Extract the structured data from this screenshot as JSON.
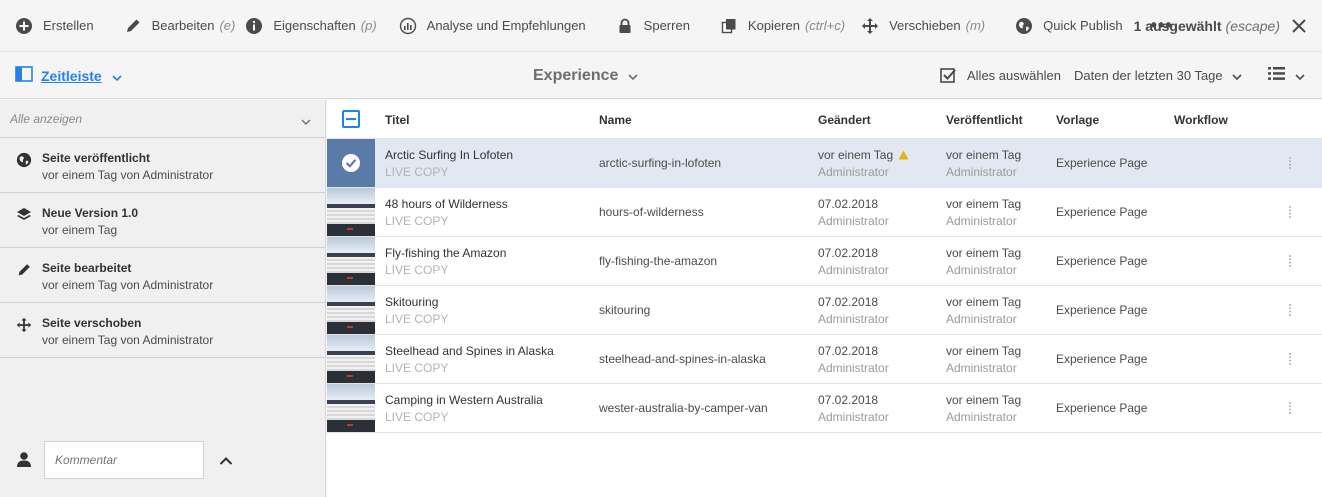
{
  "actionbar": {
    "items": [
      {
        "label": "Erstellen",
        "shortcut": "",
        "icon": "plus-circle-icon"
      },
      {
        "label": "Bearbeiten",
        "shortcut": "(e)",
        "icon": "pencil-icon"
      },
      {
        "label": "Eigenschaften",
        "shortcut": "(p)",
        "icon": "info-icon"
      },
      {
        "label": "Analyse und Empfehlungen",
        "shortcut": "",
        "icon": "analytics-icon"
      },
      {
        "label": "Sperren",
        "shortcut": "",
        "icon": "lock-icon"
      },
      {
        "label": "Kopieren",
        "shortcut": "(ctrl+c)",
        "icon": "copy-icon"
      },
      {
        "label": "Verschieben",
        "shortcut": "(m)",
        "icon": "move-icon"
      },
      {
        "label": "Quick Publish",
        "shortcut": "",
        "icon": "globe-icon"
      }
    ],
    "more": "•••",
    "selection_label": "1 ausgewählt",
    "selection_escape": "(escape)"
  },
  "subbar": {
    "rail_label": "Zeitleiste",
    "title": "Experience",
    "select_all": "Alles auswählen",
    "date_range": "Daten der letzten 30 Tage"
  },
  "rail": {
    "filter": "Alle anzeigen",
    "items": [
      {
        "title": "Seite veröffentlicht",
        "sub": "vor einem Tag von Administrator",
        "icon": "globe-icon"
      },
      {
        "title": "Neue Version 1.0",
        "sub": "vor einem Tag",
        "icon": "layers-icon"
      },
      {
        "title": "Seite bearbeitet",
        "sub": "vor einem Tag von Administrator",
        "icon": "pencil-icon"
      },
      {
        "title": "Seite verschoben",
        "sub": "vor einem Tag von Administrator",
        "icon": "move-icon"
      }
    ],
    "comment_placeholder": "Kommentar"
  },
  "table": {
    "columns": [
      "Titel",
      "Name",
      "Geändert",
      "Veröffentlicht",
      "Vorlage",
      "Workflow"
    ],
    "rows": [
      {
        "title": "Arctic Surfing In Lofoten",
        "sub": "LIVE COPY",
        "name": "arctic-surfing-in-lofoten",
        "modified": "vor einem Tag",
        "modified_by": "Administrator",
        "published": "vor einem Tag",
        "published_by": "Administrator",
        "template": "Experience Page",
        "selected": true,
        "warning": true
      },
      {
        "title": "48 hours of Wilderness",
        "sub": "LIVE COPY",
        "name": "hours-of-wilderness",
        "modified": "07.02.2018",
        "modified_by": "Administrator",
        "published": "vor einem Tag",
        "published_by": "Administrator",
        "template": "Experience Page",
        "selected": false,
        "warning": false
      },
      {
        "title": "Fly-fishing the Amazon",
        "sub": "LIVE COPY",
        "name": "fly-fishing-the-amazon",
        "modified": "07.02.2018",
        "modified_by": "Administrator",
        "published": "vor einem Tag",
        "published_by": "Administrator",
        "template": "Experience Page",
        "selected": false,
        "warning": false
      },
      {
        "title": "Skitouring",
        "sub": "LIVE COPY",
        "name": "skitouring",
        "modified": "07.02.2018",
        "modified_by": "Administrator",
        "published": "vor einem Tag",
        "published_by": "Administrator",
        "template": "Experience Page",
        "selected": false,
        "warning": false
      },
      {
        "title": "Steelhead and Spines in Alaska",
        "sub": "LIVE COPY",
        "name": "steelhead-and-spines-in-alaska",
        "modified": "07.02.2018",
        "modified_by": "Administrator",
        "published": "vor einem Tag",
        "published_by": "Administrator",
        "template": "Experience Page",
        "selected": false,
        "warning": false
      },
      {
        "title": "Camping in Western Australia",
        "sub": "LIVE COPY",
        "name": "wester-australia-by-camper-van",
        "modified": "07.02.2018",
        "modified_by": "Administrator",
        "published": "vor einem Tag",
        "published_by": "Administrator",
        "template": "Experience Page",
        "selected": false,
        "warning": false
      }
    ]
  },
  "colors": {
    "accent": "#2680eb",
    "selected_row": "#e2e8f1",
    "warning": "#e8b314"
  }
}
